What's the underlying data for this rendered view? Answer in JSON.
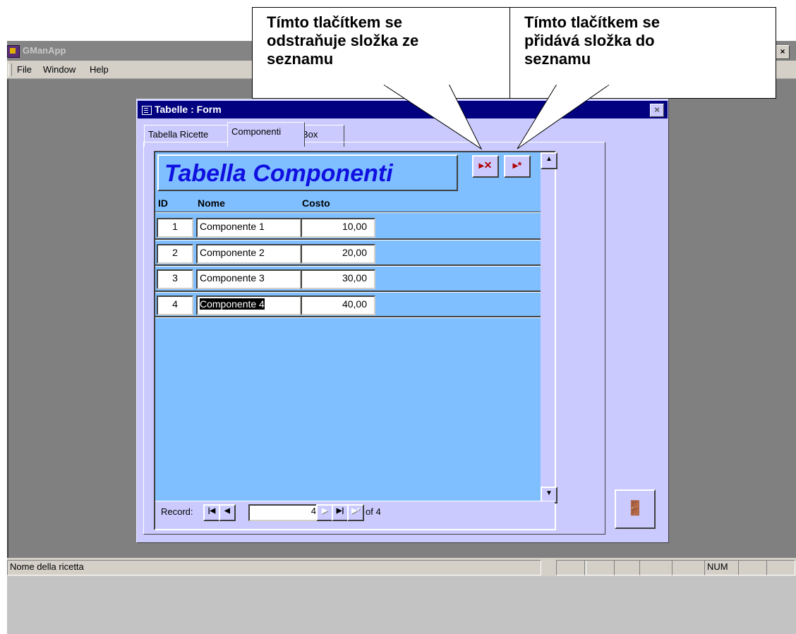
{
  "app": {
    "title": "GManApp",
    "caption_buttons": [
      "_",
      "🗗",
      "×"
    ],
    "menu": [
      "File",
      "Window",
      "Help"
    ]
  },
  "form": {
    "title": "Tabelle : Form",
    "close_label": "×",
    "tabs": [
      "Tabella Ricette",
      "Componenti",
      "Box"
    ],
    "active_tab": "Componenti",
    "header_title": "Tabella Componenti",
    "columns": [
      "ID",
      "Nome",
      "Costo"
    ],
    "rows": [
      {
        "id": "1",
        "name": "Componente 1",
        "cost": "10,00"
      },
      {
        "id": "2",
        "name": "Componente 2",
        "cost": "20,00"
      },
      {
        "id": "3",
        "name": "Componente 3",
        "cost": "30,00"
      },
      {
        "id": "4",
        "name": "Componente 4",
        "cost": "40,00"
      }
    ],
    "delete_record_glyph": "▸✕",
    "new_record_glyph": "▸*",
    "navigation": {
      "label": "Record:",
      "current": "4",
      "of_label": "of 4"
    },
    "exit_glyph": "🚪"
  },
  "callouts": {
    "delete": "Tímto tlačítkem se\nodstraňuje složka ze\nseznamu",
    "add": "Tímto tlačítkem se\npřidává složka do\nseznamu"
  },
  "statusbar": {
    "message": "Nome della ricetta",
    "num": "NUM"
  },
  "colors": {
    "form_bg": "#cacafe",
    "subform_bg": "#7fbfff",
    "title_blue": "#020280",
    "header_text": "#1010e0",
    "mdi_bg": "#808080"
  }
}
